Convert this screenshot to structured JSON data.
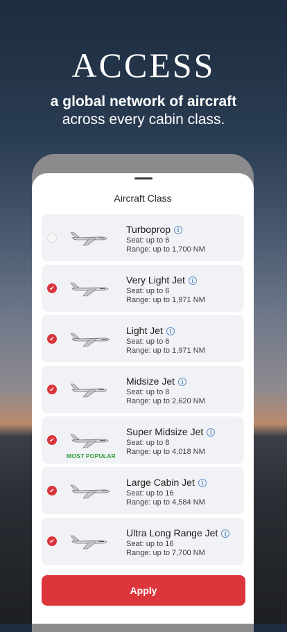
{
  "hero": {
    "title": "ACCESS",
    "subtitle_bold": "a global network of aircraft",
    "subtitle_rest": "across every cabin class."
  },
  "sheet": {
    "title": "Aircraft Class",
    "apply_label": "Apply"
  },
  "aircraft": [
    {
      "name": "Turboprop",
      "seat": "Seat:  up to 6",
      "range": "Range:  up to 1,700 NM",
      "selected": false
    },
    {
      "name": "Very Light Jet",
      "seat": "Seat:  up to 6",
      "range": "Range:  up to 1,971 NM",
      "selected": true
    },
    {
      "name": "Light Jet",
      "seat": "Seat:  up to 6",
      "range": "Range:  up to 1,971 NM",
      "selected": true
    },
    {
      "name": "Midsize Jet",
      "seat": "Seat:  up to 8",
      "range": "Range:  up to 2,620 NM",
      "selected": true
    },
    {
      "name": "Super Midsize Jet",
      "seat": "Seat:  up to 8",
      "range": "Range:  up to 4,018 NM",
      "selected": true,
      "badge": "MOST POPULAR"
    },
    {
      "name": "Large Cabin Jet",
      "seat": "Seat:  up to 16",
      "range": "Range:  up to 4,584 NM",
      "selected": true
    },
    {
      "name": "Ultra Long Range Jet",
      "seat": "Seat:  up to 16",
      "range": "Range:  up to 7,700 NM",
      "selected": true
    }
  ],
  "icons": {
    "check": "check-icon",
    "info": "info-icon",
    "aircraft": "jet-icon"
  },
  "colors": {
    "accent": "#dc353c",
    "popular": "#2d9b3b",
    "info": "#5a8fc8",
    "card": "#f1f2f5"
  }
}
